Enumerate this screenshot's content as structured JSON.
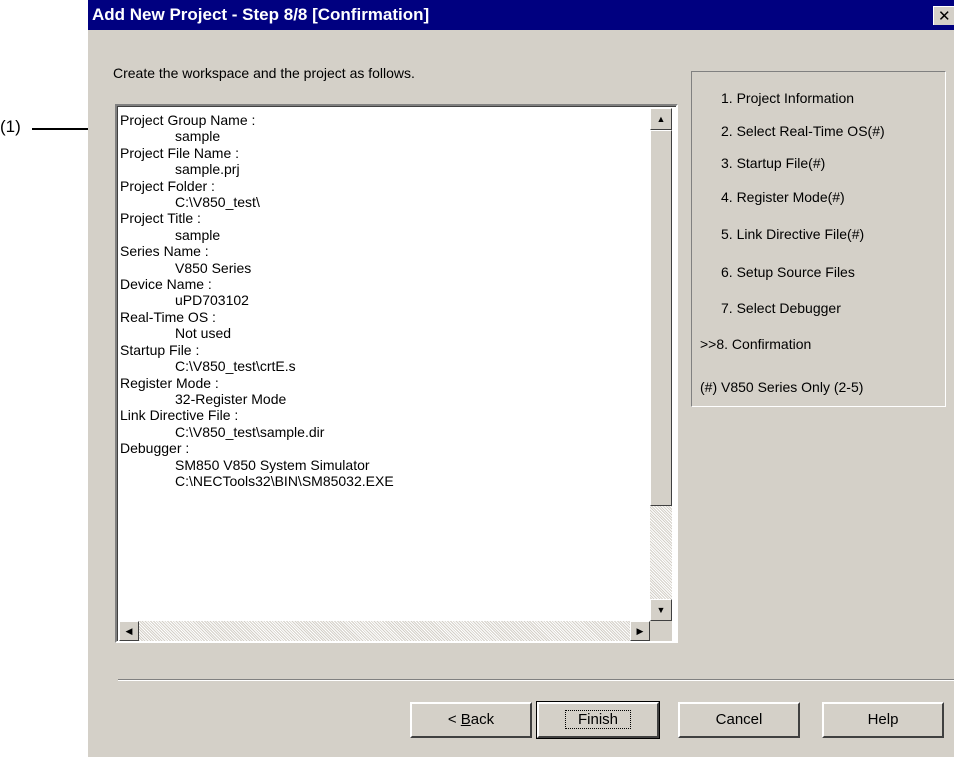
{
  "callout": {
    "label": "(1)"
  },
  "dialog": {
    "title": "Add New Project - Step 8/8 [Confirmation]",
    "close_glyph": "✕",
    "instruction": "Create the workspace and the project as follows.",
    "summary_rows": [
      {
        "text": "Project Group Name :",
        "indent": false
      },
      {
        "text": "sample",
        "indent": true
      },
      {
        "text": "Project File Name :",
        "indent": false
      },
      {
        "text": "sample.prj",
        "indent": true
      },
      {
        "text": "Project Folder :",
        "indent": false
      },
      {
        "text": "C:\\V850_test\\",
        "indent": true
      },
      {
        "text": "Project Title :",
        "indent": false
      },
      {
        "text": "sample",
        "indent": true
      },
      {
        "text": "Series Name :",
        "indent": false
      },
      {
        "text": "V850 Series",
        "indent": true
      },
      {
        "text": "Device Name :",
        "indent": false
      },
      {
        "text": "uPD703102",
        "indent": true
      },
      {
        "text": "Real-Time OS :",
        "indent": false
      },
      {
        "text": "Not used",
        "indent": true
      },
      {
        "text": "Startup File :",
        "indent": false
      },
      {
        "text": "C:\\V850_test\\crtE.s",
        "indent": true
      },
      {
        "text": "Register Mode :",
        "indent": false
      },
      {
        "text": "32-Register Mode",
        "indent": true
      },
      {
        "text": "Link Directive File :",
        "indent": false
      },
      {
        "text": "C:\\V850_test\\sample.dir",
        "indent": true
      },
      {
        "text": "Debugger :",
        "indent": false
      },
      {
        "text": "SM850 V850 System Simulator",
        "indent": true
      },
      {
        "text": "C:\\NECTools32\\BIN\\SM85032.EXE",
        "indent": true
      }
    ],
    "steps": [
      "1. Project Information",
      "2. Select Real-Time OS(#)",
      "3. Startup File(#)",
      "4. Register Mode(#)",
      "5. Link Directive File(#)",
      "6. Setup Source Files",
      "7. Select Debugger",
      ">>8. Confirmation",
      "(#) V850 Series Only (2-5)"
    ],
    "buttons": {
      "back_prefix": "< ",
      "back_mnemonic": "B",
      "back_rest": "ack",
      "finish": "Finish",
      "cancel": "Cancel",
      "help": "Help"
    }
  }
}
